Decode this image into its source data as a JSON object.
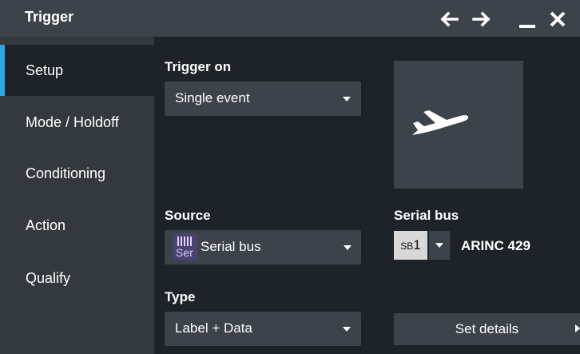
{
  "window": {
    "title": "Trigger",
    "controls": [
      "arrow-left-icon",
      "arrow-right-icon",
      "minimize-icon",
      "close-icon"
    ]
  },
  "sidebar": {
    "items": [
      {
        "label": "Setup",
        "active": true
      },
      {
        "label": "Mode / Holdoff",
        "active": false
      },
      {
        "label": "Conditioning",
        "active": false
      },
      {
        "label": "Action",
        "active": false
      },
      {
        "label": "Qualify",
        "active": false
      }
    ]
  },
  "main": {
    "trigger_on": {
      "label": "Trigger on",
      "value": "Single event"
    },
    "preview_icon": "airplane-icon",
    "source": {
      "label": "Source",
      "icon_text": "Ser",
      "value": "Serial bus"
    },
    "serial_bus": {
      "label": "Serial bus",
      "chip_prefix": "SB",
      "chip_number": "1",
      "protocol": "ARINC 429"
    },
    "type": {
      "label": "Type",
      "value": "Label + Data"
    },
    "set_details": {
      "label": "Set details"
    }
  },
  "colors": {
    "background": "#1e2329",
    "panel": "#3d434b",
    "sidebar": "#33393f",
    "accent": "#2aa6e0",
    "serial_icon": "#4a4370"
  }
}
